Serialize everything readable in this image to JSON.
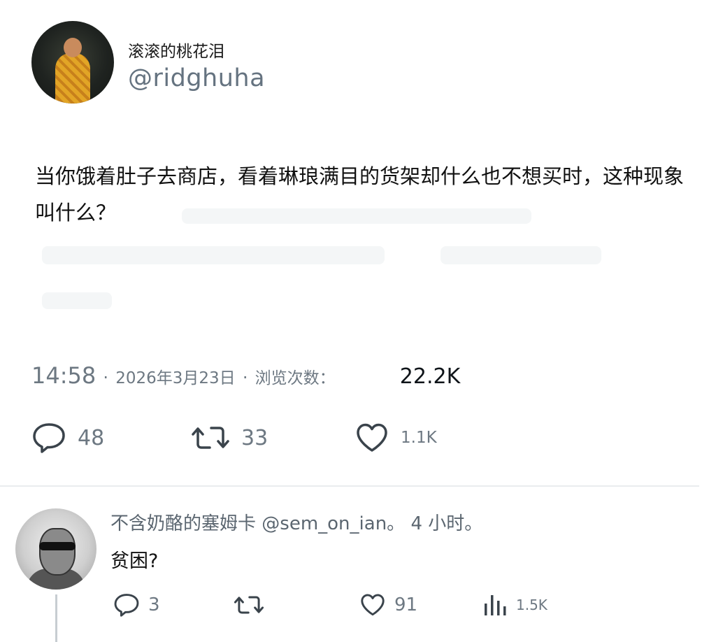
{
  "tweet": {
    "display_name": "滚滚的桃花泪",
    "handle": "@ridghuha",
    "text": "当你饿着肚子去商店，看着琳琅满目的货架却什么也不想买时，这种现象叫什么？",
    "time": "14:58",
    "date": "2026年3月23日",
    "views_label": "浏览次数：",
    "views_count": "22.2K",
    "separator": "·",
    "actions": {
      "reply_icon": "reply-icon",
      "reply_count": "48",
      "retweet_icon": "retweet-icon",
      "retweet_count": "33",
      "like_icon": "heart-icon",
      "like_count": "1.1K"
    }
  },
  "reply": {
    "display_name": "不含奶酪的塞姆卡",
    "handle": "@sem_on_ian",
    "time": "4 小时",
    "punct": "。",
    "text": "贫困?",
    "actions": {
      "reply_count": "3",
      "retweet_count": "",
      "like_count": "91",
      "views_icon": "analytics-icon",
      "views_count": "1.5K"
    }
  },
  "colors": {
    "text": "#0f1419",
    "secondary": "#6d7882",
    "divider": "#e9ecee",
    "background": "#ffffff"
  }
}
